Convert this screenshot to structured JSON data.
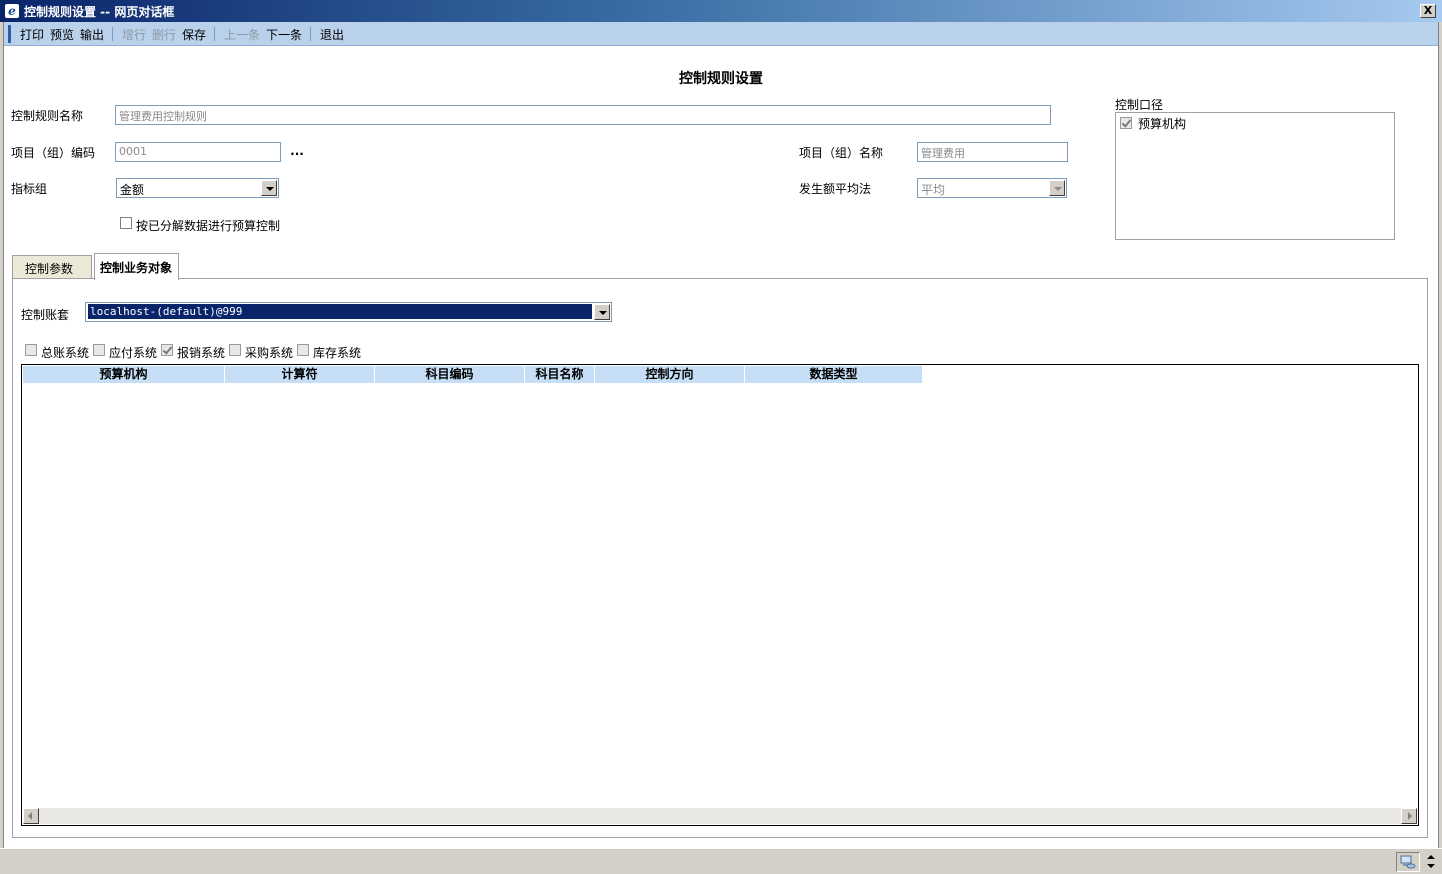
{
  "window": {
    "title": "控制规则设置  --  网页对话框",
    "close_label": "X"
  },
  "toolbar": {
    "print": "打印",
    "preview": "预览",
    "export": "输出",
    "add_row": "增行",
    "delete_row": "删行",
    "save": "保存",
    "prev": "上一条",
    "next": "下一条",
    "exit": "退出"
  },
  "form": {
    "page_title": "控制规则设置",
    "rule_name_label": "控制规则名称",
    "rule_name_value": "管理费用控制规则",
    "project_code_label": "项目（组）编码",
    "project_code_value": "0001",
    "browse_label": "...",
    "project_name_label": "项目（组）名称",
    "project_name_value": "管理费用",
    "indicator_group_label": "指标组",
    "indicator_group_value": "金额",
    "avg_method_label": "发生额平均法",
    "avg_method_value": "平均",
    "decomposed_checkbox_label": "按已分解数据进行预算控制",
    "decomposed_checked": false
  },
  "control_scope": {
    "label": "控制口径",
    "items": [
      {
        "label": "预算机构",
        "checked": true
      }
    ]
  },
  "tabs": [
    {
      "label": "控制参数",
      "active": false
    },
    {
      "label": "控制业务对象",
      "active": true
    }
  ],
  "business_objects": {
    "account_set_label": "控制账套",
    "account_set_value": "localhost-(default)@999",
    "systems": [
      {
        "label": "总账系统",
        "checked": false
      },
      {
        "label": "应付系统",
        "checked": false
      },
      {
        "label": "报销系统",
        "checked": true
      },
      {
        "label": "采购系统",
        "checked": false
      },
      {
        "label": "库存系统",
        "checked": false
      }
    ],
    "columns": [
      "预算机构",
      "计算符",
      "科目编码",
      "科目名称",
      "控制方向",
      "数据类型"
    ],
    "rows": []
  },
  "colors": {
    "title_bar": "#0a246a",
    "toolbar_bg": "#b9d1ea",
    "grid_header_bg": "#c6dff7",
    "selection": "#0a246a"
  },
  "icons": {
    "window_icon": "ie-icon",
    "status_icon": "computer-network-icon"
  }
}
